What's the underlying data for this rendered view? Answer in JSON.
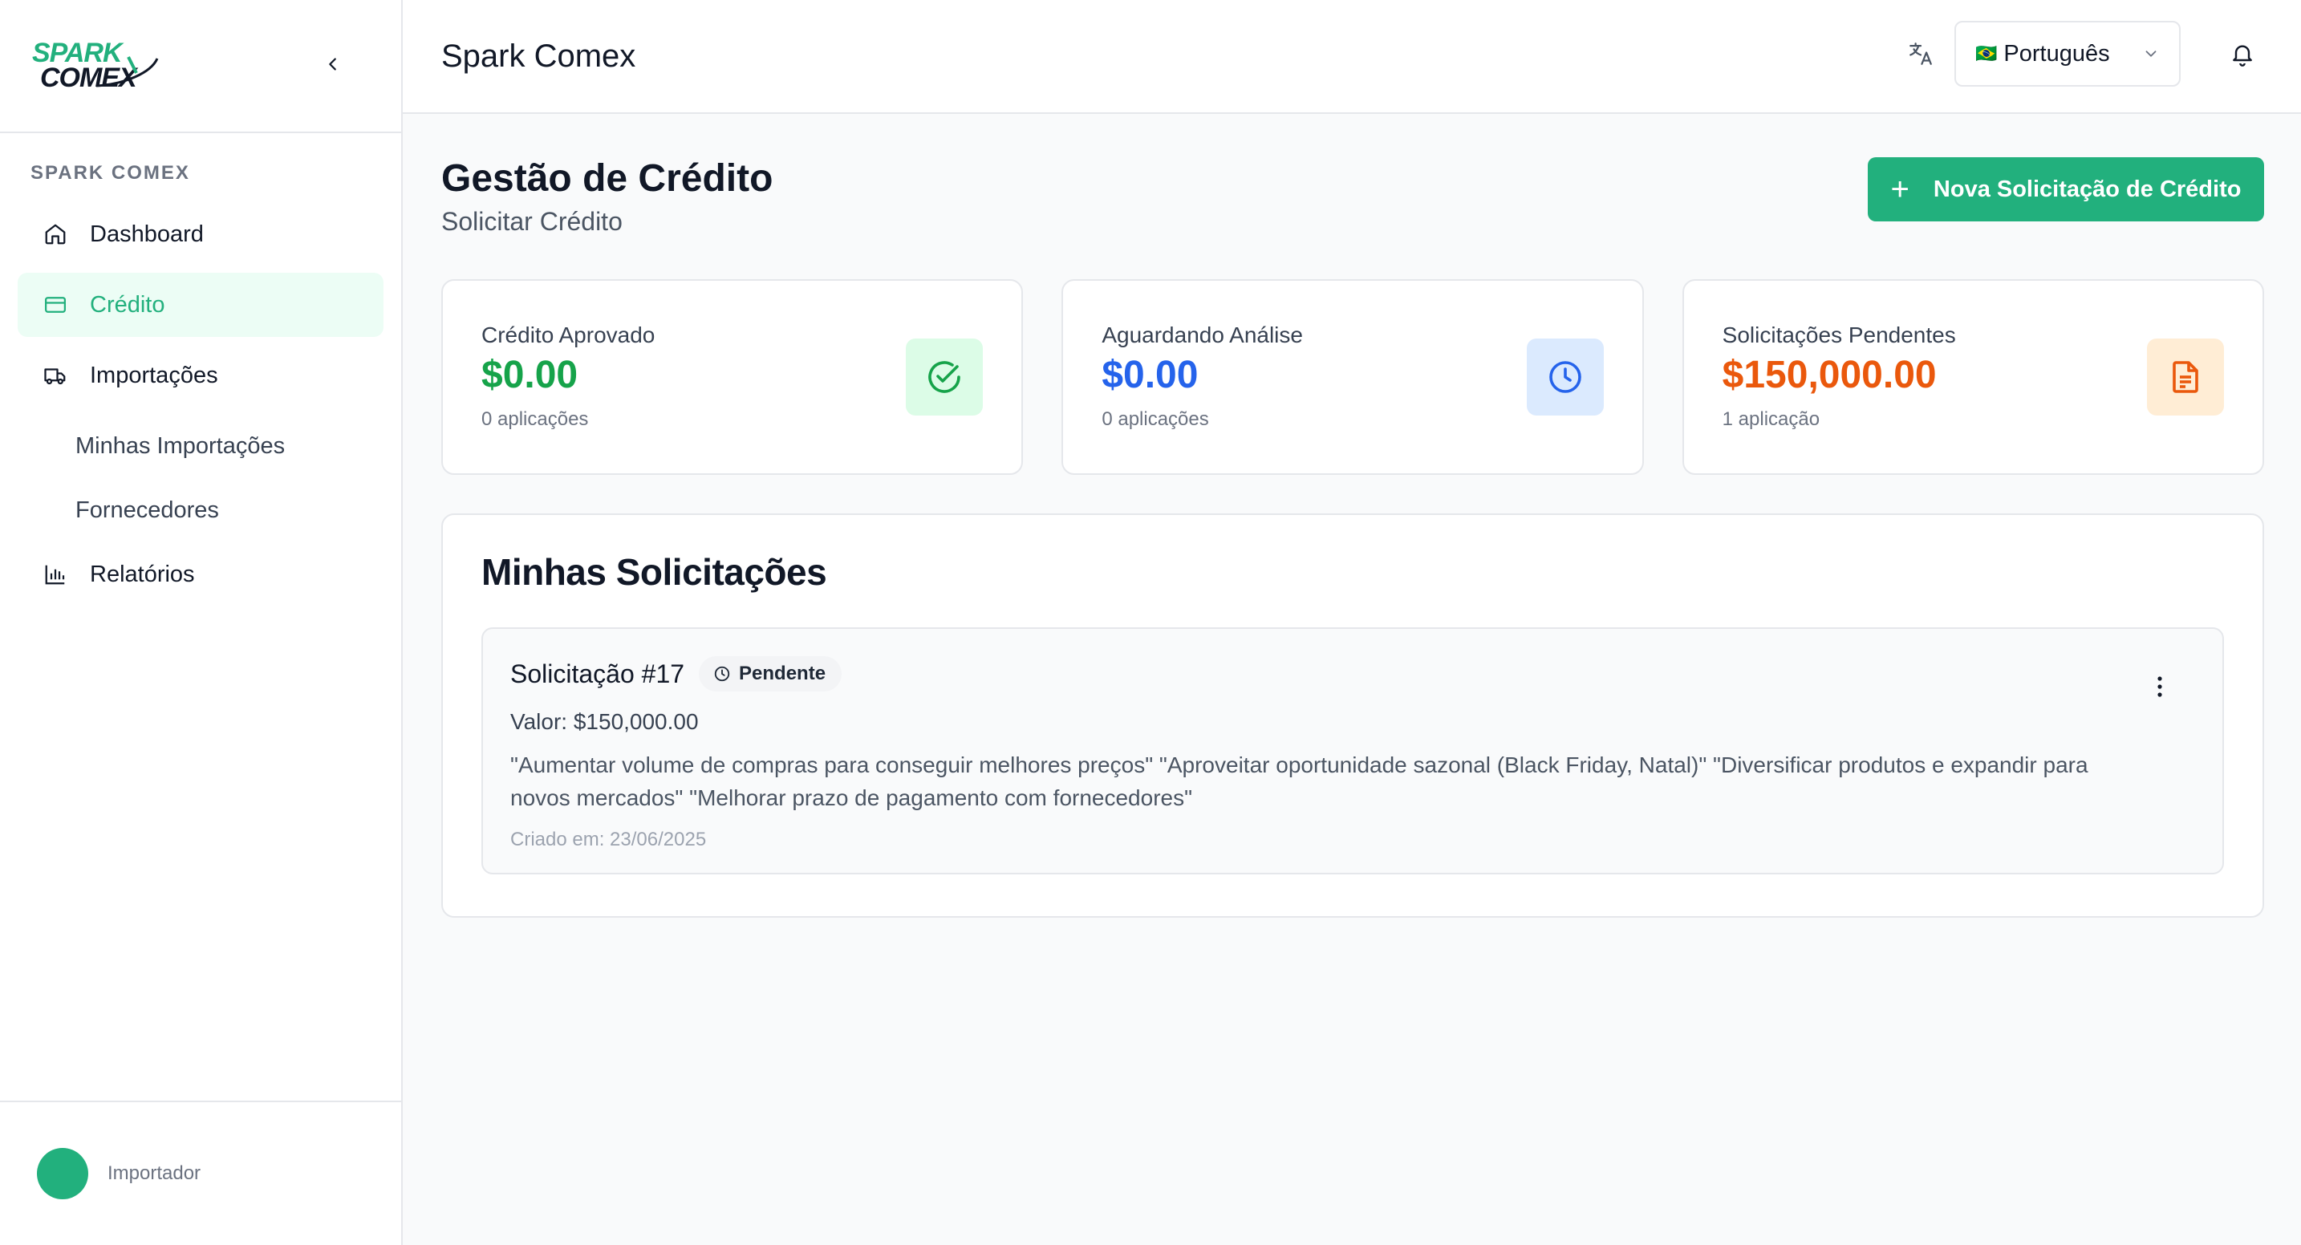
{
  "sidebar": {
    "logo_line1": "SPARK",
    "logo_line2": "COMEX",
    "section_label": "SPARK COMEX",
    "nav": {
      "dashboard": "Dashboard",
      "credito": "Crédito",
      "importacoes": "Importações",
      "minhas_importacoes": "Minhas Importações",
      "fornecedores": "Fornecedores",
      "relatorios": "Relatórios"
    },
    "active_item": "credito",
    "user_role": "Importador"
  },
  "topbar": {
    "app_title": "Spark Comex",
    "language": "Português",
    "language_flag": "🇧🇷"
  },
  "page": {
    "title": "Gestão de Crédito",
    "subtitle": "Solicitar Crédito",
    "new_request_button": "Nova Solicitação de Crédito"
  },
  "stats": [
    {
      "label": "Crédito Aprovado",
      "value": "$0.00",
      "count": "0 aplicações",
      "color": "#16a34a",
      "icon": "check-circle-icon"
    },
    {
      "label": "Aguardando Análise",
      "value": "$0.00",
      "count": "0 aplicações",
      "color": "#2563eb",
      "icon": "clock-icon"
    },
    {
      "label": "Solicitações Pendentes",
      "value": "$150,000.00",
      "count": "1 aplicação",
      "color": "#ea580c",
      "icon": "document-icon"
    }
  ],
  "requests": {
    "title": "Minhas Solicitações",
    "items": [
      {
        "name": "Solicitação #17",
        "status": "Pendente",
        "value": "Valor: $150,000.00",
        "description": "\"Aumentar volume de compras para conseguir melhores preços\" \"Aproveitar oportunidade sazonal (Black Friday, Natal)\" \"Diversificar produtos e expandir para novos mercados\" \"Melhorar prazo de pagamento com fornecedores\"",
        "created": "Criado em: 23/06/2025"
      }
    ]
  },
  "colors": {
    "brand": "#22b07d",
    "active_bg": "#ecfdf5"
  }
}
